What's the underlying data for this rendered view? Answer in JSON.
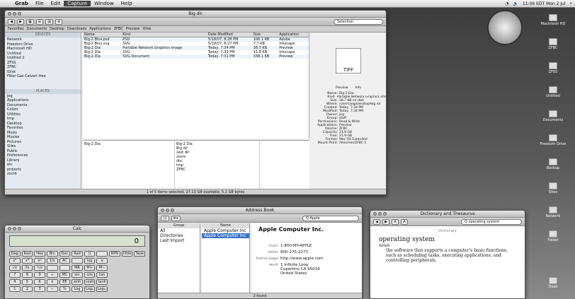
{
  "menubar": {
    "items": [
      "Grab",
      "File",
      "Edit",
      "Capture",
      "Window",
      "Help"
    ],
    "clock": "11:06 EDT Mon 2 Jul"
  },
  "finder": {
    "title": "Big dir",
    "search_placeholder": "Selection",
    "path": [
      "Favorites",
      "Documents",
      "Desktop",
      "Downloads",
      "Applications",
      "ZFBC",
      "Preview",
      "iDisk"
    ],
    "sidebar_top": [
      "Network",
      "Freedom Drive",
      "Macintosh HD",
      "Untitled",
      "Untitled 2",
      "ZFSS",
      "ZFBC",
      "iDisk",
      "Filter Gas Calvert free"
    ],
    "sidebar_places": [
      "jeg",
      "Applications",
      "Documents",
      "Colors",
      "Utilities",
      "tmp",
      "Desktop",
      "Favorites",
      "Music",
      "Movies",
      "Pictures",
      "Sites",
      "Public",
      "Preferences",
      "Library",
      "etc",
      "projects",
      "xscrd"
    ],
    "columns": [
      "Name",
      "Kind",
      "Date Modified",
      "Size",
      "Application"
    ],
    "rows": [
      [
        "Big-2.Bios.psd",
        "PSD",
        "5/18/07, 8:28 PM",
        "106.1 KB",
        "Adobe"
      ],
      [
        "Big-2.Bios.svg",
        "SVG",
        "5/18/07, 8:27 PM",
        "7.7 KB",
        "Inkscape"
      ],
      [
        "Big-2.Dia",
        "Portable Network Graphics image",
        "Today, 7:34 PM",
        "38.7 KB",
        "Preview"
      ],
      [
        "Big-2.Dia",
        "SVG",
        "Today, 7:33 PM",
        "11.8 KB",
        "Inkscape"
      ],
      [
        "Big-2.Dia",
        "SVG Document",
        "Today, 7:31 PM",
        "338.1 KB",
        "Preview"
      ]
    ],
    "column_browser": [
      "Big-2.Dia",
      "Big-2.Dia",
      "Big dir",
      "zest dir",
      "zoom",
      "doc",
      "tmp",
      "ZFBC"
    ],
    "status": "1 of 5 items selected, 27.13 GB available, 5.1 GB bytes"
  },
  "preview": {
    "title": "Preview",
    "file_type": "TIFF",
    "tabs": [
      "Preview",
      "Info"
    ],
    "info": [
      [
        "Name:",
        "Big-2.Dia"
      ],
      [
        "Kind:",
        "Portable Network Graphics image"
      ],
      [
        "Size:",
        "38.7 KB on disk"
      ],
      [
        "Where:",
        "/Users/jeg/Desktop/Big dir"
      ],
      [
        "Created:",
        "Today, 7:34 PM"
      ],
      [
        "Modified:",
        "Today, 7:34 PM"
      ],
      [
        "Owner:",
        "jeg"
      ],
      [
        "Group:",
        "staff"
      ],
      [
        "Permissions:",
        "Read & Write"
      ],
      [
        "Applications:",
        "Preview"
      ],
      [
        "Volume:",
        "ZFBC"
      ],
      [
        "Capacity:",
        "21.9 GB"
      ],
      [
        "Free:",
        "21.9 GB"
      ],
      [
        "Format:",
        "Mac OS Extended"
      ],
      [
        "Mount Point:",
        "/Volumes/ZFBC-1"
      ]
    ]
  },
  "calculator": {
    "title": "Calc",
    "display": "0",
    "rows": [
      [
        "Deg",
        "Rad",
        "Hex",
        "Bin",
        "Dec",
        "Rad",
        "()",
        "",
        "RPN",
        "little",
        "Tape"
      ],
      [
        "x²",
        "x³",
        "xʸ",
        "1/x",
        "AC",
        "",
        "log",
        "e",
        "",
        "",
        ""
      ],
      [
        "√x",
        "∛x",
        "ʸ√x",
        "",
        "",
        "MR",
        "M+",
        "M−",
        "",
        "",
        ""
      ],
      [
        "7",
        "8",
        "9",
        "÷",
        "MC",
        "sin",
        "cos",
        "tan",
        "",
        "",
        ""
      ],
      [
        "4",
        "5",
        "6",
        "×",
        "EE",
        "sinh",
        "cosh",
        "tanh",
        "",
        "",
        ""
      ],
      [
        "1",
        "2",
        "3",
        "−",
        "%",
        "Log",
        "Log₂",
        "Log₁₀",
        "",
        "",
        ""
      ],
      [
        "0",
        "000",
        ".",
        "+",
        "=",
        "Rand",
        "EE",
        "Log₂",
        "",
        "",
        ""
      ]
    ]
  },
  "addressbook": {
    "title": "Address Book",
    "search_value": "Q Apple",
    "groups_header": "Group",
    "names_header": "Name",
    "groups": [
      "All",
      "Directories",
      "Last Import"
    ],
    "names": [
      "Apple Computer Inc",
      "Apple Computer Inc"
    ],
    "card": {
      "company": "Apple Computer Inc.",
      "fields": [
        [
          "main",
          "1-800-MY-APPLE"
        ],
        [
          "other",
          "800-275-2273"
        ],
        [
          "home page",
          "http://www.apple.com"
        ],
        [
          "work",
          "1 Infinite Loop\nCupertino CA 95014\nUnited States"
        ]
      ]
    },
    "card_count": "2 found"
  },
  "dictionary": {
    "title": "Dictionary and Thesaurus",
    "search_value": "Q operating system",
    "tab": "Dictionary",
    "headword": "operating system",
    "pos": "noun",
    "definition": "the software that supports a computer's basic functions, such as scheduling tasks, executing applications, and controlling peripherals."
  },
  "dock_right": [
    "Macintosh HD",
    "ZFBC",
    "ZFSS",
    "Untitled",
    "Documents",
    "Freedom Drive",
    "Backup",
    "Sites",
    "Network",
    "Folder",
    "Trash"
  ]
}
